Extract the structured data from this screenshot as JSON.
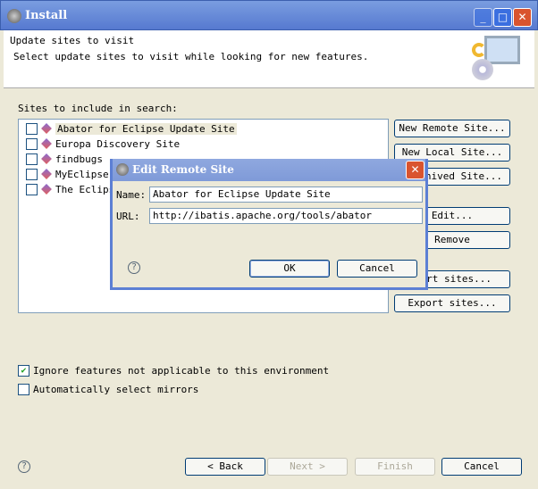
{
  "window": {
    "title": "Install"
  },
  "header": {
    "title": "Update sites to visit",
    "description": "Select update sites to visit while looking for new features."
  },
  "sites_label": "Sites to include in search:",
  "sites": [
    {
      "label": "Abator for Eclipse Update Site",
      "checked": false,
      "selected": true
    },
    {
      "label": "Europa Discovery Site",
      "checked": false
    },
    {
      "label": "findbugs",
      "checked": false
    },
    {
      "label": "MyEclipse",
      "checked": false
    },
    {
      "label": "The Eclips",
      "checked": false
    }
  ],
  "side_buttons": {
    "new_remote": "New Remote Site...",
    "new_local": "New Local Site...",
    "new_archived": "rchived Site...",
    "edit": "Edit...",
    "remove": "Remove",
    "import": "ort sites...",
    "export": "Export sites..."
  },
  "options": {
    "ignore": "Ignore features not applicable to this environment",
    "ignore_checked": true,
    "mirrors": "Automatically select mirrors",
    "mirrors_checked": false
  },
  "footer": {
    "back": "< Back",
    "next": "Next >",
    "finish": "Finish",
    "cancel": "Cancel"
  },
  "dialog": {
    "title": "Edit Remote Site",
    "name_label": "Name:",
    "name_value": "Abator for Eclipse Update Site",
    "url_label": "URL:",
    "url_value": "http://ibatis.apache.org/tools/abator",
    "ok": "OK",
    "cancel": "Cancel"
  }
}
